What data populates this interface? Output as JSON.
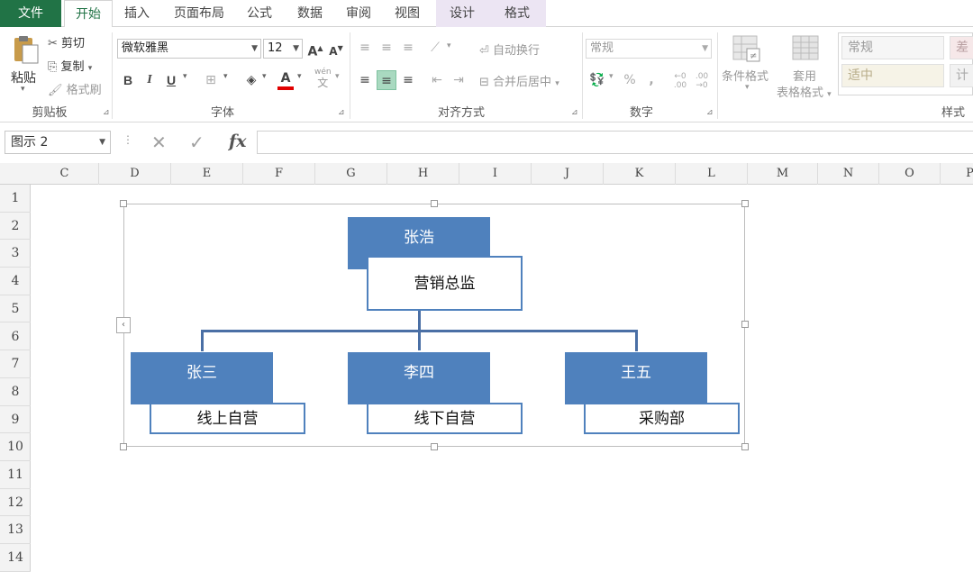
{
  "tabs": {
    "file": "文件",
    "home": "开始",
    "insert": "插入",
    "page_layout": "页面布局",
    "formulas": "公式",
    "data": "数据",
    "review": "审阅",
    "view": "视图",
    "design": "设计",
    "format": "格式"
  },
  "ribbon": {
    "clipboard": {
      "paste": "粘贴",
      "cut": "剪切",
      "copy": "复制",
      "format_painter": "格式刷",
      "label": "剪贴板"
    },
    "font": {
      "font_name": "微软雅黑",
      "font_size": "12",
      "bold": "B",
      "italic": "I",
      "underline": "U",
      "font_color_glyph": "A",
      "phonetic_glyph": "wén",
      "phonetic_sub": "文",
      "label": "字体"
    },
    "alignment": {
      "wrap_text": "自动换行",
      "merge_center": "合并后居中",
      "label": "对齐方式"
    },
    "number": {
      "format": "常规",
      "percent": "%",
      "comma": ",",
      "label": "数字"
    },
    "styles": {
      "conditional_formatting": "条件格式",
      "format_as_table_1": "套用",
      "format_as_table_2": "表格格式",
      "style_normal": "常规",
      "style_bad": "差",
      "style_neutral": "适中",
      "style_calc": "计",
      "label": "样式"
    }
  },
  "formula_bar": {
    "name_box": "图示 2",
    "fx": "fx",
    "content": ""
  },
  "columns": [
    "C",
    "D",
    "E",
    "F",
    "G",
    "H",
    "I",
    "J",
    "K",
    "L",
    "M",
    "N",
    "O",
    "P"
  ],
  "rows": [
    "1",
    "2",
    "3",
    "4",
    "5",
    "6",
    "7",
    "8",
    "9",
    "10",
    "11",
    "12",
    "13",
    "14"
  ],
  "org_chart": {
    "top": {
      "name": "张浩",
      "title": "营销总监"
    },
    "children": [
      {
        "name": "张三",
        "title": "线上自营"
      },
      {
        "name": "李四",
        "title": "线下自营"
      },
      {
        "name": "王五",
        "title": "采购部"
      }
    ]
  },
  "colors": {
    "excel_green": "#217346",
    "node_fill": "#4f81bd",
    "connector": "#4a6fa5",
    "context_tab": "#ece5f3"
  }
}
